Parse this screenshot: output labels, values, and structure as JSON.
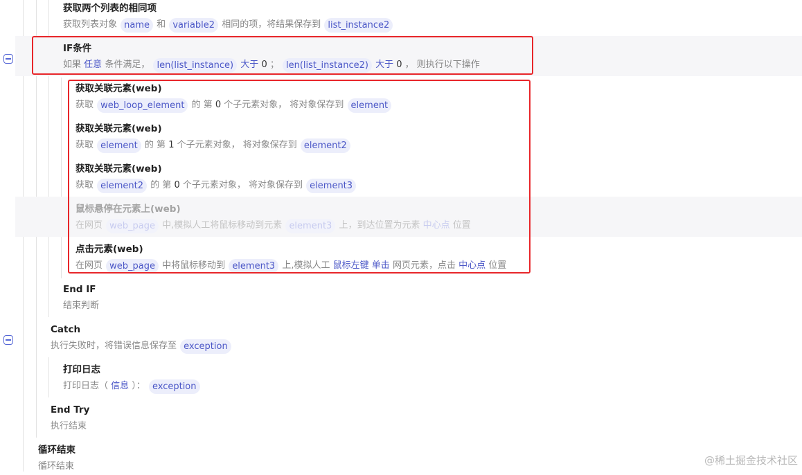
{
  "steps": {
    "intersect": {
      "title": "获取两个列表的相同项",
      "t1": "获取列表对象",
      "v1": "name",
      "t2": "和",
      "v2": "variable2",
      "t3": "相同的项，将结果保存到",
      "v3": "list_instance2"
    },
    "if": {
      "title": "IF条件",
      "t1": "如果",
      "kw1": "任意",
      "t2": "条件满足，",
      "v1": "len(list_instance)",
      "kw2": "大于",
      "n1": "0",
      "t3": "；",
      "v2": "len(list_instance2)",
      "kw3": "大于",
      "n2": "0",
      "t4": "，  则执行以下操作"
    },
    "rel1": {
      "title": "获取关联元素(web)",
      "t1": "获取",
      "v1": "web_loop_element",
      "t2": "的 第",
      "n1": "0",
      "t3": "个子元素对象，  将对象保存到",
      "v2": "element"
    },
    "rel2": {
      "title": "获取关联元素(web)",
      "t1": "获取",
      "v1": "element",
      "t2": "的 第",
      "n1": "1",
      "t3": "个子元素对象，  将对象保存到",
      "v2": "element2"
    },
    "rel3": {
      "title": "获取关联元素(web)",
      "t1": "获取",
      "v1": "element2",
      "t2": "的 第",
      "n1": "0",
      "t3": "个子元素对象，  将对象保存到",
      "v2": "element3"
    },
    "hover": {
      "title": "鼠标悬停在元素上(web)",
      "t1": "在网页",
      "v1": "web_page",
      "t2": "中,模拟人工将鼠标移动到元素",
      "v2": "element3",
      "t3": "上，到达位置为元素",
      "kw1": "中心点",
      "t4": "位置"
    },
    "click": {
      "title": "点击元素(web)",
      "t1": "在网页",
      "v1": "web_page",
      "t2": "中将鼠标移动到",
      "v2": "element3",
      "t3": "上,模拟人工",
      "kw1": "鼠标左键",
      "kw2": "单击",
      "t4": "网页元素，点击",
      "kw3": "中心点",
      "t5": "位置"
    },
    "endif": {
      "title": "End IF",
      "desc": "结束判断"
    },
    "catch": {
      "title": "Catch",
      "t1": "执行失败时，将错误信息保存至",
      "v1": "exception"
    },
    "log": {
      "title": "打印日志",
      "t1": "打印日志（",
      "kw1": "信息",
      "t2": "）：",
      "v1": "exception"
    },
    "endtry": {
      "title": "End Try",
      "desc": "执行结束"
    },
    "loopend": {
      "title": "循环结束",
      "desc": "循环结束"
    }
  },
  "watermark": "@稀土掘金技术社区",
  "icons": {
    "collapse": "collapse-minus-icon"
  },
  "colors": {
    "highlight_box": "#e8262a",
    "variable_pill_bg": "#eceefb",
    "variable_pill_text": "#4b57c7",
    "accent": "#5466d6"
  }
}
